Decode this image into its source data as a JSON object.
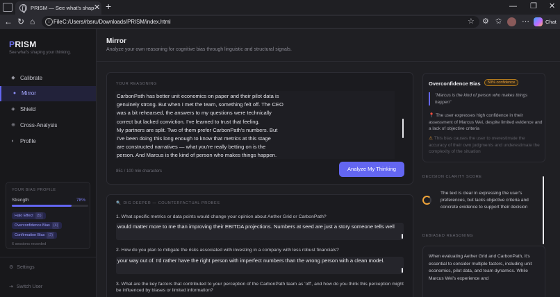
{
  "browser": {
    "tab_title": "PRISM — See what's shaping your",
    "tab_close": "✕",
    "new_tab": "+",
    "window_controls": [
      "—",
      "❐",
      "✕"
    ],
    "nav": {
      "back": "←",
      "forward": "→",
      "reload": "↻",
      "home": "⌂"
    },
    "address_info": "i",
    "address_scheme": "File",
    "address_url": "C:/Users/rbsru/Downloads/PRISM/index.html",
    "chat_label": "Chat",
    "icons": [
      "star-icon",
      "extensions-icon",
      "favorites-icon",
      "collections-icon",
      "profile-avatar",
      "more-icon",
      "copilot-icon"
    ]
  },
  "sidebar": {
    "logo_accent": "P",
    "logo_rest": "RISM",
    "tagline": "See what's shaping your thinking.",
    "items": [
      {
        "label": "Calibrate",
        "icon": "◆",
        "active": false
      },
      {
        "label": "Mirror",
        "icon": "●",
        "active": true
      },
      {
        "label": "Shield",
        "icon": "◈",
        "active": false
      },
      {
        "label": "Cross-Analysis",
        "icon": "⊕",
        "active": false
      },
      {
        "label": "Profile",
        "icon": "◐",
        "active": false
      }
    ],
    "bias_profile": {
      "title": "YOUR BIAS PROFILE",
      "strength_label": "Strength",
      "strength_value": "78%",
      "strength_fraction": 0.78,
      "chips": [
        {
          "label": "Halo Effect",
          "count": "(5)"
        },
        {
          "label": "Overconfidence Bias",
          "count": "(4)"
        },
        {
          "label": "Confirmation Bias",
          "count": "(2)"
        }
      ],
      "sessions": "6 sessions recorded"
    },
    "settings": "Settings",
    "switch_user": "Switch User"
  },
  "main": {
    "title": "Mirror",
    "subtitle": "Analyze your own reasoning for cognitive bias through linguistic and structural signals.",
    "reasoning_label": "YOUR REASONING",
    "reasoning_lines": [
      "CarbonPath has better unit economics on paper and their pilot data is",
      "genuinely strong. But when I met the team, something felt off. The CEO",
      "was a bit rehearsed, the answers to my questions were technically",
      "correct but lacked conviction. I've learned to trust that feeling.",
      "My partners are split. Two of them prefer CarbonPath's numbers. But",
      "I've been doing this long enough to know that metrics at this stage",
      "are constructed narratives — what you're really betting on is the",
      "person. And Marcus is the kind of person who makes things happen."
    ],
    "char_count": "851 / 100 min characters",
    "analyze_button": "Analyze My Thinking",
    "dig_deeper_label": "DIG DEEPER — COUNTERFACTUAL PROBES",
    "dig_icon": "🔍",
    "probes": [
      {
        "question": "1. What specific metrics or data points would change your opinion about Aether Grid or CarbonPath?",
        "answer": "would matter more to me than improving their EBITDA projections. Numbers at seed are just a story someone tells well"
      },
      {
        "question": "2. How do you plan to mitigate the risks associated with investing in a company with less robust financials?",
        "answer": "your way out of. I'd rather have the right person with imperfect numbers than the wrong person with a clean model."
      },
      {
        "question": "3. What are the key factors that contributed to your perception of the CarbonPath team as 'off', and how do you think this perception might be influenced by biases or limited information?",
        "answer": ""
      }
    ]
  },
  "analysis": {
    "bias_title": "Overconfidence Bias",
    "confidence": "50% confidence",
    "quote": "\"Marcus is the kind of person who makes things happen\"",
    "finding": "The user expresses high confidence in their assessment of Marcus Wei, despite limited evidence and a lack of objective criteria",
    "effect": "This bias causes the user to overestimate the accuracy of their own judgments and underestimate the complexity of the situation",
    "clarity_label": "DECISION CLARITY SCORE",
    "clarity_text": "The text is clear in expressing the user's preferences, but lacks objective criteria and concrete evidence to support their decision",
    "debiased_label": "DEBIASED REASONING",
    "debiased_text": "When evaluating Aether Grid and CarbonPath, it's essential to consider multiple factors, including unit economics, pilot data, and team dynamics. While Marcus Wei's experience and",
    "accent_color": "#6366f1",
    "warning_color": "#f0a43a"
  }
}
